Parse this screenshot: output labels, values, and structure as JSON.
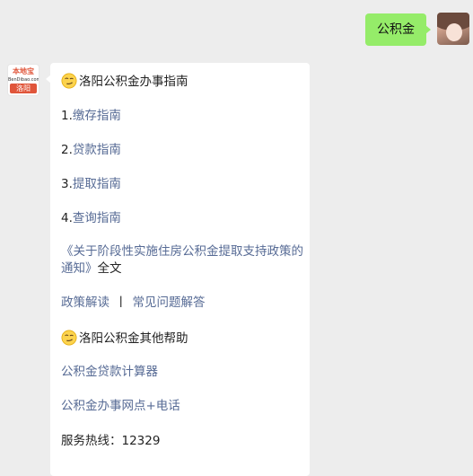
{
  "user_message": {
    "text": "公积金"
  },
  "bot_avatar": {
    "logo": "本地宝",
    "site": "BenDibao.com",
    "city": "洛阳"
  },
  "bot_message": {
    "section1_title": "洛阳公积金办事指南",
    "items": [
      {
        "prefix": "1.",
        "link": "缴存指南"
      },
      {
        "prefix": "2.",
        "link": "贷款指南"
      },
      {
        "prefix": "3.",
        "link": "提取指南"
      },
      {
        "prefix": "4.",
        "link": "查询指南"
      }
    ],
    "policy_link": "《关于阶段性实施住房公积金提取支持政策的通知》",
    "policy_suffix": "全文",
    "policy_read": "政策解读",
    "separator": "丨",
    "faq": "常见问题解答",
    "section2_title": "洛阳公积金其他帮助",
    "calculator": "公积金贷款计算器",
    "outlets": "公积金办事网点+电话",
    "hotline_label": "服务热线：",
    "hotline_number": "12329"
  },
  "colors": {
    "background": "#ededed",
    "user_bubble": "#95ec69",
    "bot_bubble": "#ffffff",
    "link": "#576b95"
  },
  "icons": {
    "emoji": "smirk-face-icon"
  }
}
